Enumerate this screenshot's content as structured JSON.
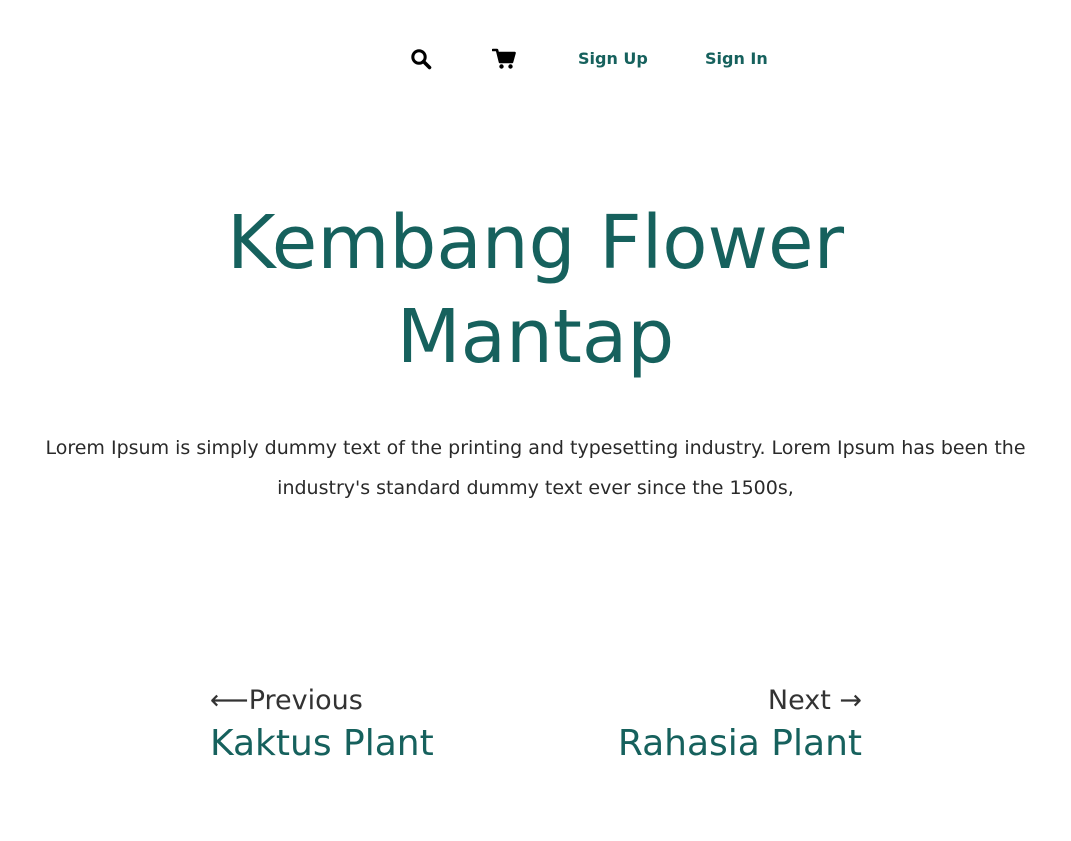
{
  "nav": {
    "search_icon": "search-icon",
    "cart_icon": "cart-icon",
    "sign_up": "Sign Up",
    "sign_in": "Sign In"
  },
  "hero": {
    "title_line1": "Kembang Flower",
    "title_line2": "Mantap",
    "description": "Lorem Ipsum is simply dummy text of the printing and typesetting industry. Lorem Ipsum has been the industry's standard dummy text ever since the 1500s,"
  },
  "post_nav": {
    "prev_arrow": "⟵",
    "prev_label": "Previous",
    "prev_title": "Kaktus Plant",
    "next_label": "Next",
    "next_arrow": "→",
    "next_title": "Rahasia Plant"
  },
  "colors": {
    "accent": "#16615d",
    "text": "#2a2a2a",
    "icon": "#000000"
  }
}
